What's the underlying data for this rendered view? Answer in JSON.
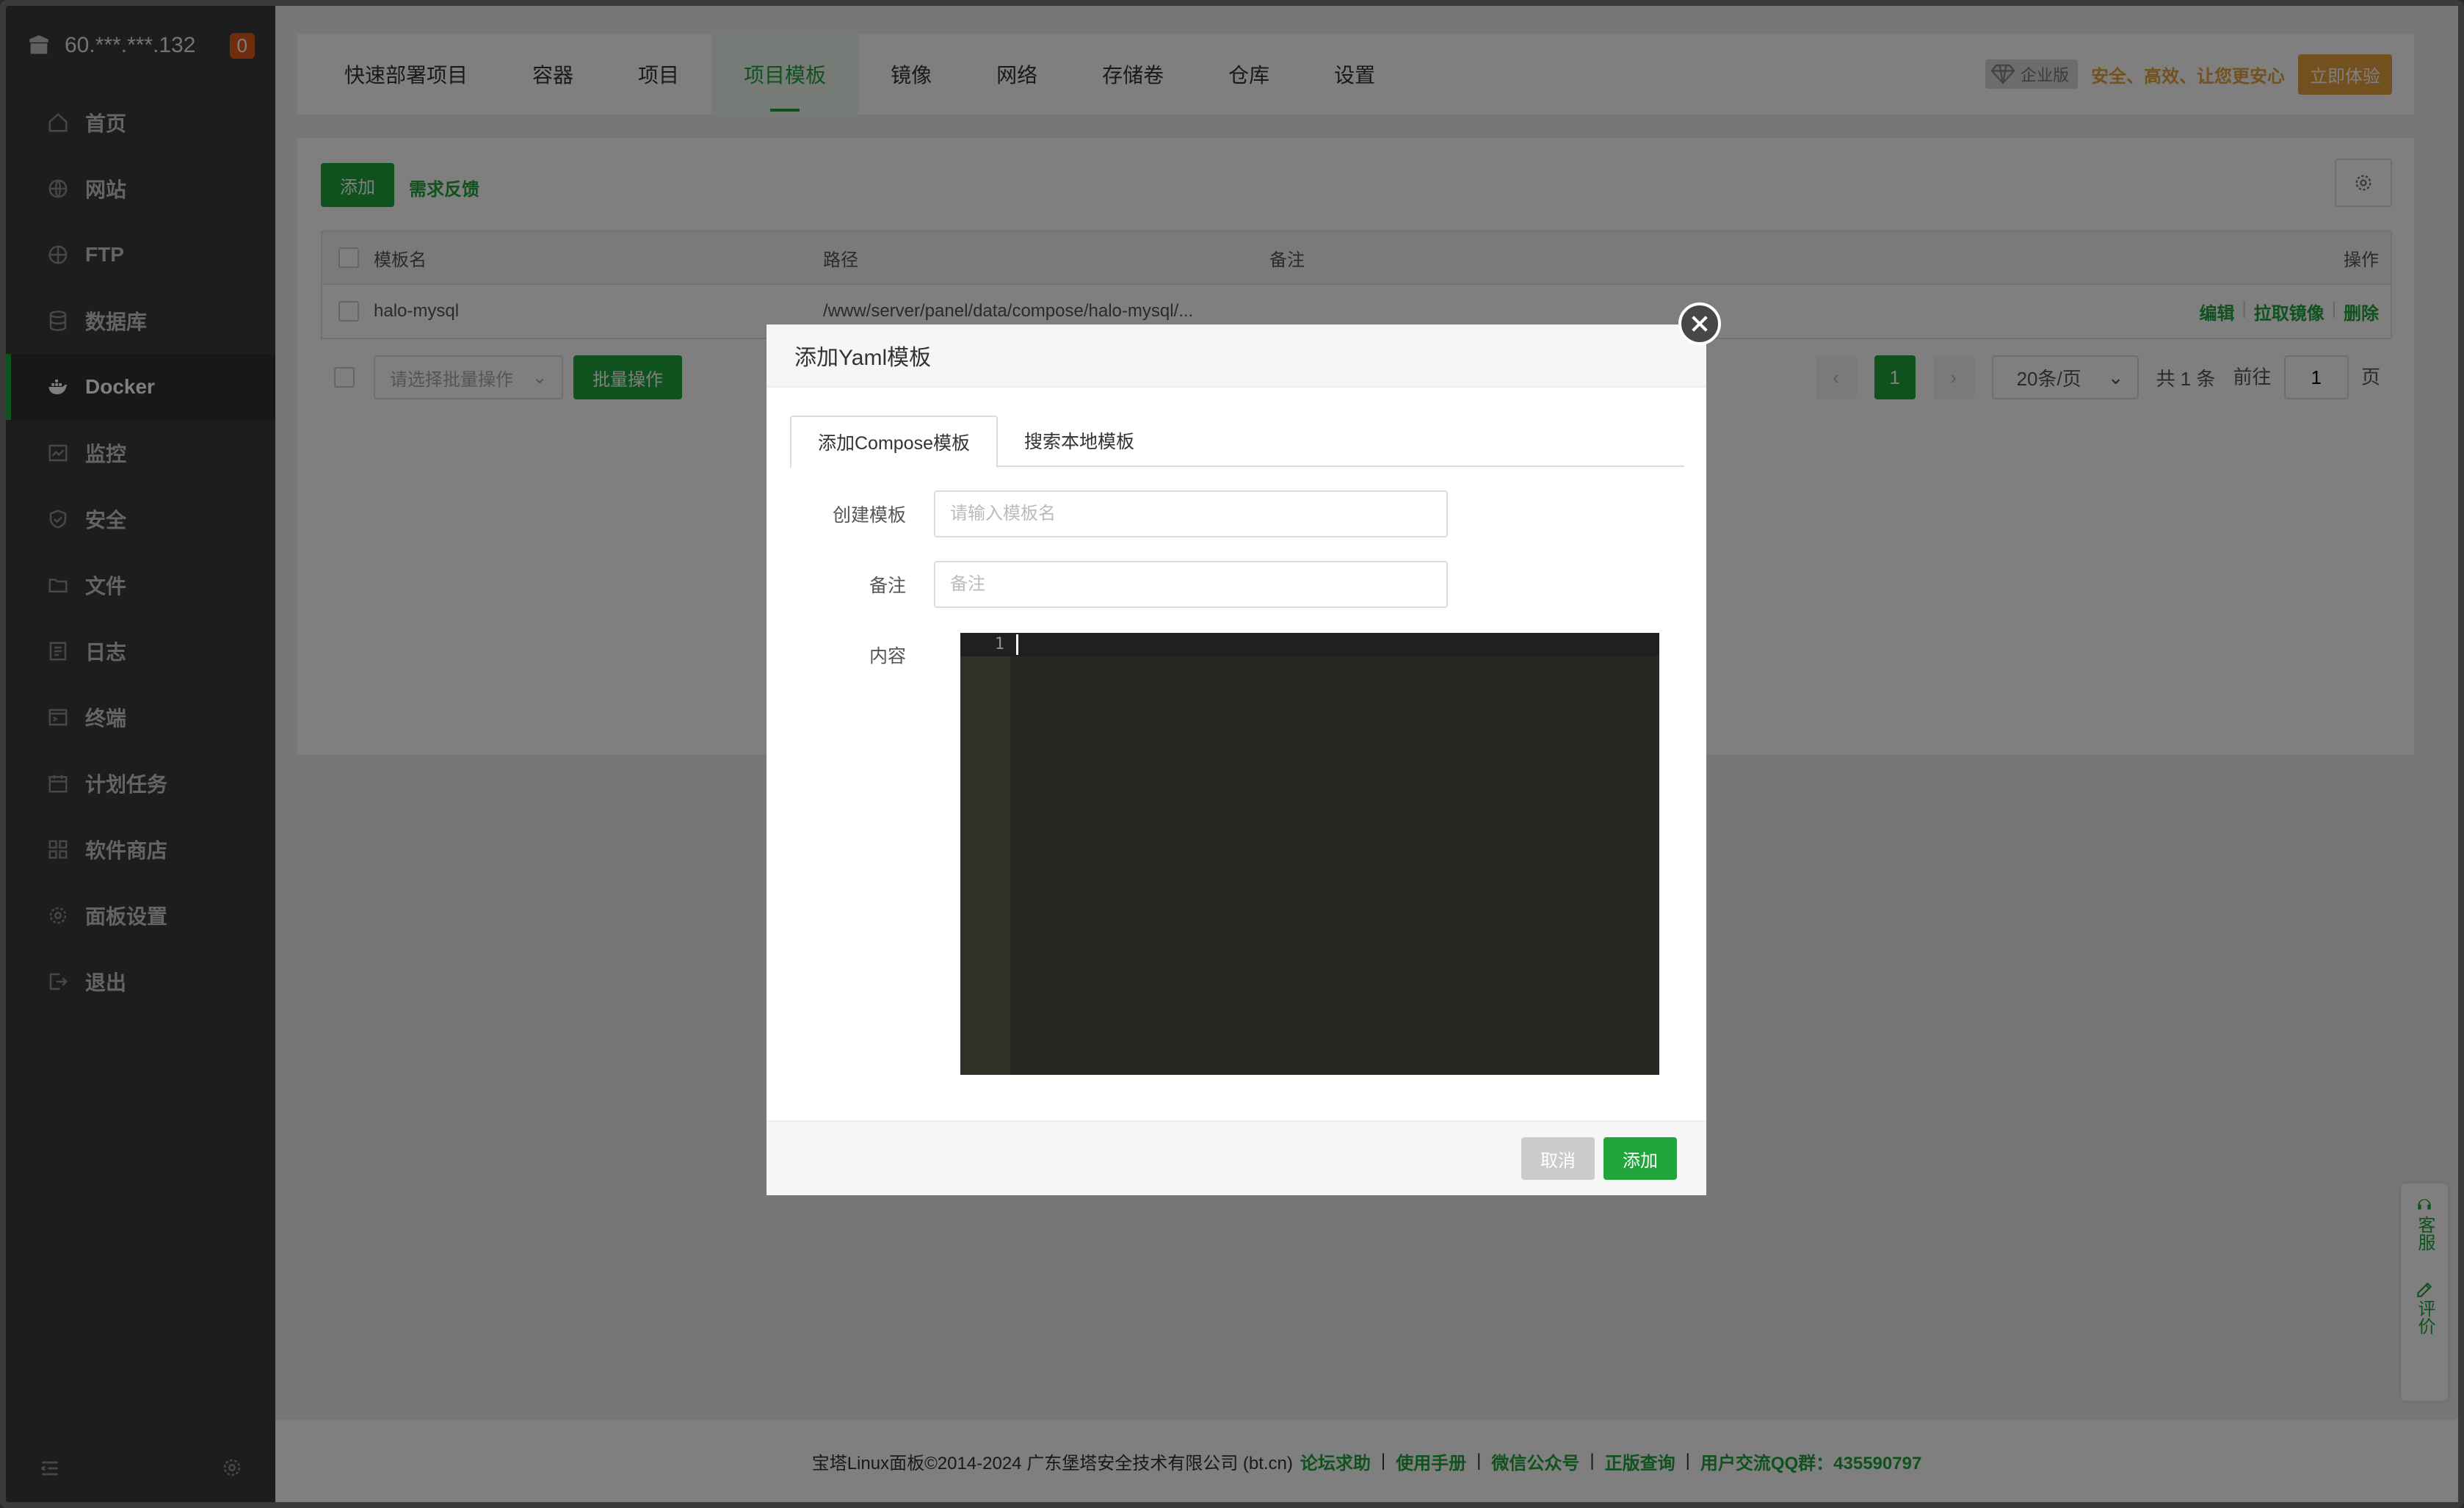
{
  "sidebar": {
    "server": "60.***.***.132",
    "badge": "0",
    "items": [
      {
        "label": "首页",
        "icon": "home-icon"
      },
      {
        "label": "网站",
        "icon": "globe-icon"
      },
      {
        "label": "FTP",
        "icon": "ftp-icon"
      },
      {
        "label": "数据库",
        "icon": "database-icon"
      },
      {
        "label": "Docker",
        "icon": "docker-icon",
        "active": true
      },
      {
        "label": "监控",
        "icon": "monitor-icon"
      },
      {
        "label": "安全",
        "icon": "shield-icon"
      },
      {
        "label": "文件",
        "icon": "folder-icon"
      },
      {
        "label": "日志",
        "icon": "log-icon"
      },
      {
        "label": "终端",
        "icon": "terminal-icon"
      },
      {
        "label": "计划任务",
        "icon": "calendar-icon"
      },
      {
        "label": "软件商店",
        "icon": "grid-icon"
      },
      {
        "label": "面板设置",
        "icon": "gear-icon"
      },
      {
        "label": "退出",
        "icon": "logout-icon"
      }
    ]
  },
  "tabs": [
    "快速部署项目",
    "容器",
    "项目",
    "项目模板",
    "镜像",
    "网络",
    "存储卷",
    "仓库",
    "设置"
  ],
  "active_tab": "项目模板",
  "promo": {
    "tag": "企业版",
    "slogan": "安全、高效、让您更安心",
    "button": "立即体验"
  },
  "toolbar": {
    "add": "添加",
    "feedback": "需求反馈"
  },
  "table": {
    "headers": {
      "name": "模板名",
      "path": "路径",
      "note": "备注",
      "ops": "操作"
    },
    "rows": [
      {
        "name": "halo-mysql",
        "path": "/www/server/panel/data/compose/halo-mysql/...",
        "note": "",
        "ops": [
          "编辑",
          "拉取镜像",
          "删除"
        ]
      }
    ]
  },
  "bulk": {
    "placeholder": "请选择批量操作",
    "button": "批量操作"
  },
  "pager": {
    "current": "1",
    "page_size": "20条/页",
    "total": "共 1 条",
    "goto_label": "前往",
    "goto_value": "1",
    "page_unit": "页"
  },
  "footer": {
    "copyright": "宝塔Linux面板©2014-2024 广东堡塔安全技术有限公司 (bt.cn)",
    "links": [
      "论坛求助",
      "使用手册",
      "微信公众号",
      "正版查询",
      "用户交流QQ群：435590797"
    ]
  },
  "float": {
    "service": "客服",
    "review": "评价"
  },
  "dialog": {
    "title": "添加Yaml模板",
    "tabs": [
      "添加Compose模板",
      "搜索本地模板"
    ],
    "fields": {
      "name_label": "创建模板",
      "name_placeholder": "请输入模板名",
      "note_label": "备注",
      "note_placeholder": "备注",
      "content_label": "内容"
    },
    "editor": {
      "line": "1"
    },
    "cancel": "取消",
    "submit": "添加"
  }
}
